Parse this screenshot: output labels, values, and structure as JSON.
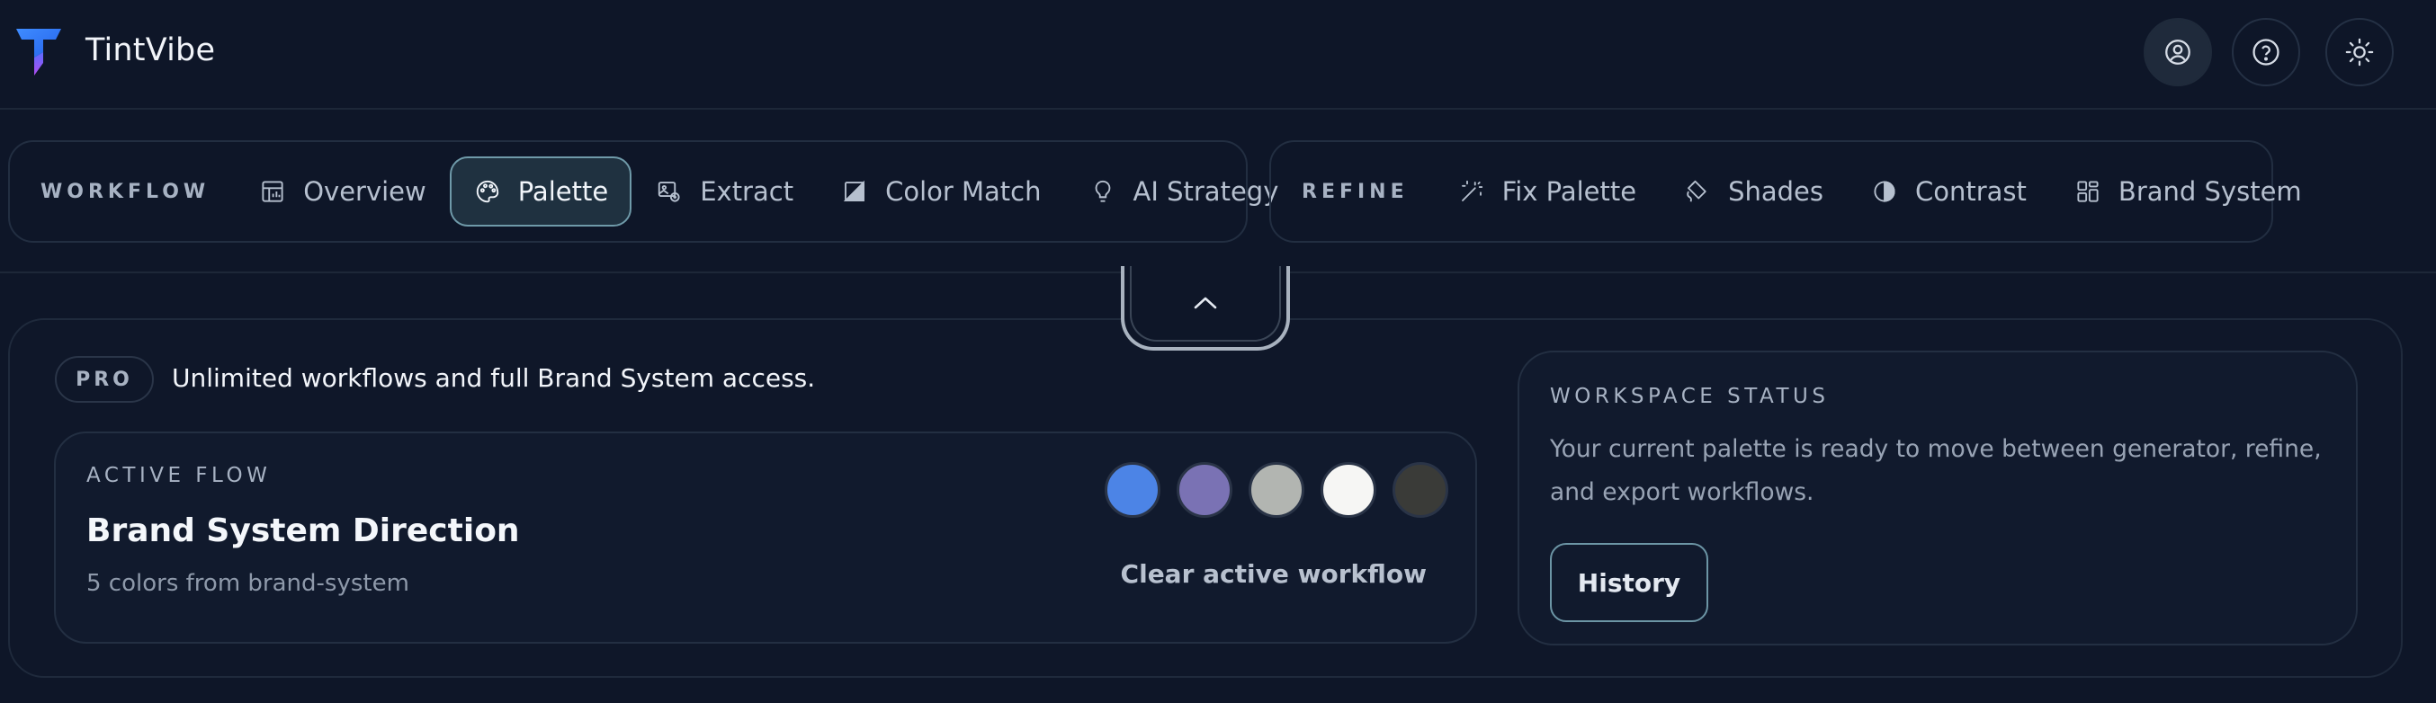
{
  "app": {
    "name": "TintVibe"
  },
  "header": {
    "buttons": [
      {
        "icon": "user-icon"
      },
      {
        "icon": "help-icon"
      },
      {
        "icon": "sun-icon"
      }
    ]
  },
  "nav": {
    "workflow": {
      "label": "WORKFLOW",
      "items": [
        {
          "label": "Overview",
          "icon": "overview-icon",
          "active": false
        },
        {
          "label": "Palette",
          "icon": "palette-icon",
          "active": true
        },
        {
          "label": "Extract",
          "icon": "extract-icon",
          "active": false
        },
        {
          "label": "Color Match",
          "icon": "color-match-icon",
          "active": false
        },
        {
          "label": "AI Strategy",
          "icon": "lightbulb-icon",
          "active": false
        }
      ]
    },
    "refine": {
      "label": "REFINE",
      "items": [
        {
          "label": "Fix Palette",
          "icon": "magic-wand-icon"
        },
        {
          "label": "Shades",
          "icon": "paint-bucket-icon"
        },
        {
          "label": "Contrast",
          "icon": "contrast-icon"
        },
        {
          "label": "Brand System",
          "icon": "grid-icon"
        }
      ]
    }
  },
  "plan": {
    "badge": "PRO",
    "text": "Unlimited workflows and full Brand System access."
  },
  "active_flow": {
    "label": "ACTIVE FLOW",
    "title": "Brand System Direction",
    "subtitle": "5 colors from brand-system",
    "swatches": [
      "#4c84e6",
      "#7a72b4",
      "#b2b5b1",
      "#f6f6f4",
      "#3a3b38"
    ],
    "clear_label": "Clear active workflow"
  },
  "workspace_status": {
    "label": "WORKSPACE STATUS",
    "description": "Your current palette is ready to move between generator, refine, and export workflows.",
    "history_label": "History"
  }
}
